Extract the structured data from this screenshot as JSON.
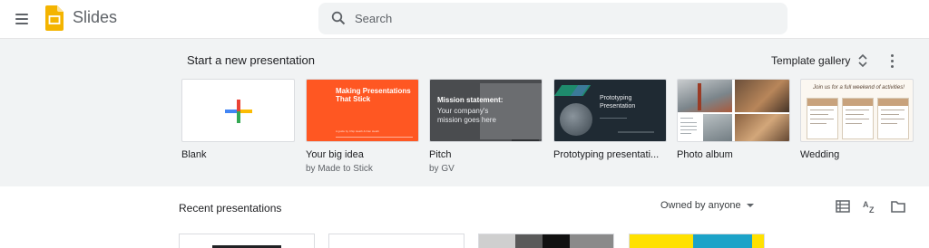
{
  "app": {
    "name": "Slides"
  },
  "search": {
    "placeholder": "Search"
  },
  "templates_section": {
    "title": "Start a new presentation",
    "gallery_label": "Template gallery",
    "templates": [
      {
        "name": "Blank",
        "subtitle": ""
      },
      {
        "name": "Your big idea",
        "subtitle": "by Made to Stick",
        "thumb_title": "Making Presentations That Stick",
        "thumb_sub": "A guide by Chip Heath & Dan Heath"
      },
      {
        "name": "Pitch",
        "subtitle": "by GV",
        "thumb_title": "Mission statement:",
        "thumb_body": "Your company's mission goes here"
      },
      {
        "name": "Prototyping presentati...",
        "subtitle": "",
        "thumb_title": "Prototyping Presentation"
      },
      {
        "name": "Photo album",
        "subtitle": ""
      },
      {
        "name": "Wedding",
        "subtitle": "",
        "thumb_title": "Join us for a full weekend of activities!"
      }
    ]
  },
  "recent_section": {
    "title": "Recent presentations",
    "owner_filter": "Owned by anyone",
    "view_buttons": [
      "list-view-icon",
      "sort-az-icon",
      "folder-icon"
    ]
  },
  "colors": {
    "accent_yellow": "#f4b400",
    "template_bg": "#f1f3f4",
    "idea_orange": "#ff5722"
  }
}
